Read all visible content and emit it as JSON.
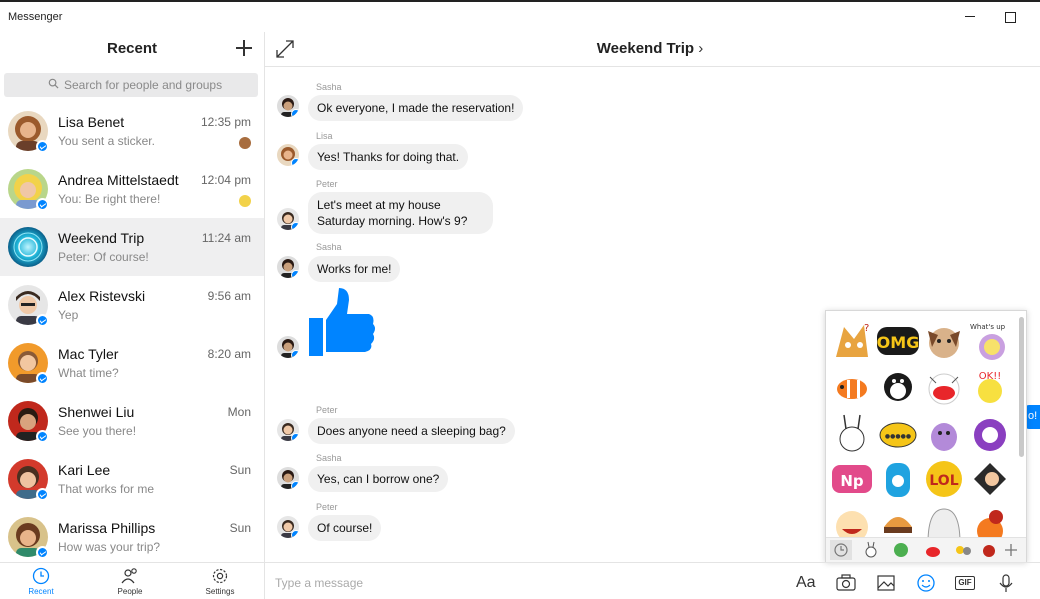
{
  "window": {
    "title": "Messenger"
  },
  "sidebar": {
    "title": "Recent",
    "search_placeholder": "Search for people and groups",
    "conversations": [
      {
        "name": "Lisa Benet",
        "time": "12:35 pm",
        "preview": "You sent a sticker."
      },
      {
        "name": "Andrea Mittelstaedt",
        "time": "12:04 pm",
        "preview": "You: Be right there!"
      },
      {
        "name": "Weekend Trip",
        "time": "11:24 am",
        "preview": "Peter: Of course!"
      },
      {
        "name": "Alex Ristevski",
        "time": "9:56 am",
        "preview": "Yep"
      },
      {
        "name": "Mac Tyler",
        "time": "8:20 am",
        "preview": "What time?"
      },
      {
        "name": "Shenwei Liu",
        "time": "Mon",
        "preview": "See you there!"
      },
      {
        "name": "Kari Lee",
        "time": "Sun",
        "preview": "That works for me"
      },
      {
        "name": "Marissa Phillips",
        "time": "Sun",
        "preview": "How was your trip?"
      }
    ],
    "nav": {
      "recent": "Recent",
      "people": "People",
      "settings": "Settings"
    }
  },
  "chat": {
    "title": "Weekend Trip",
    "title_chevron": "›",
    "messages": [
      {
        "sender": "Sasha",
        "text": "Ok everyone, I made the reservation!"
      },
      {
        "sender": "Lisa",
        "text": "Yes! Thanks for doing that."
      },
      {
        "sender": "Peter",
        "text": "Let's meet at my house Saturday morning. How's 9?"
      },
      {
        "sender": "Sasha",
        "text": "Works for me!"
      },
      {
        "sender": "Peter",
        "text": "Does anyone need a sleeping bag?"
      },
      {
        "sender": "Sasha",
        "text": "Yes, can I borrow one?"
      },
      {
        "sender": "Peter",
        "text": "Of course!"
      }
    ],
    "peek_text": "o!",
    "compose_placeholder": "Type a message",
    "compose_buttons": {
      "format": "Aa",
      "gif": "GIF"
    }
  },
  "sticker_stickers": {
    "omg": "OMG",
    "np": "Np",
    "lol": "LOL",
    "ok": "OK!!",
    "whats_up": "What's up",
    "ticket": "●●●●●"
  },
  "colors": {
    "accent": "#0084ff",
    "bubble": "#f0f0f0",
    "active_row": "#efeff0"
  }
}
